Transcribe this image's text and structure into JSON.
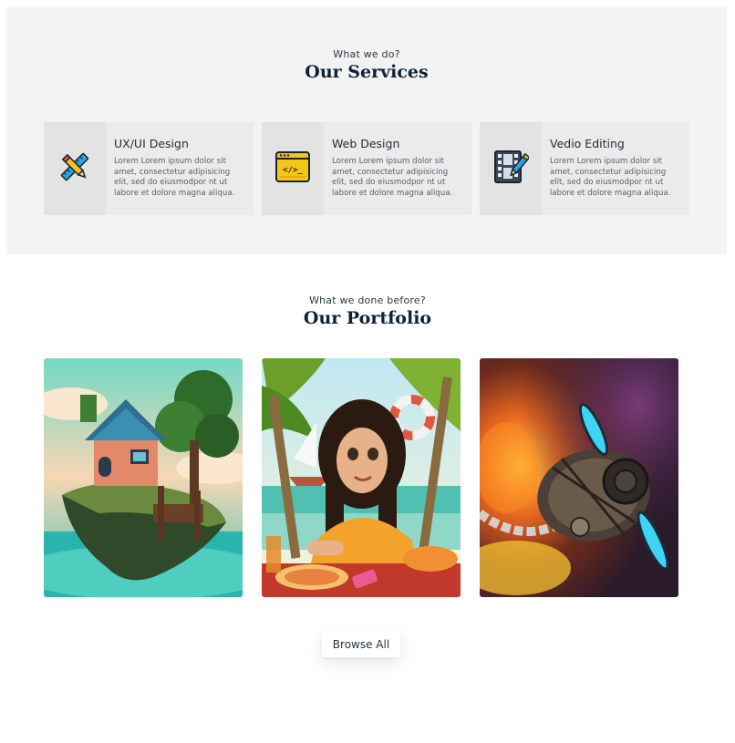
{
  "services": {
    "eyebrow": "What we do?",
    "title": "Our Services",
    "items": [
      {
        "title": "UX/UI Design",
        "text": "Lorem Lorem ipsum dolor sit amet, consectetur adipisicing elit, sed do eiusmodpor nt ut labore et dolore magna aliqua.",
        "icon": "pencil-ruler-icon"
      },
      {
        "title": "Web Design",
        "text": "Lorem Lorem ipsum dolor sit amet, consectetur adipisicing elit, sed do eiusmodpor nt ut labore et dolore magna aliqua.",
        "icon": "code-window-icon",
        "icon_code": "</>_"
      },
      {
        "title": "Vedio Editing",
        "text": "Lorem Lorem ipsum dolor sit amet, consectetur adipisicing elit, sed do eiusmodpor nt ut labore et dolore magna aliqua.",
        "icon": "film-edit-icon"
      }
    ]
  },
  "portfolio": {
    "eyebrow": "What we done before?",
    "title": "Our Portfolio",
    "items": [
      {
        "subject": "floating-island-house-illustration"
      },
      {
        "subject": "beach-girl-illustration"
      },
      {
        "subject": "steampunk-airship-illustration"
      }
    ],
    "browse_label": "Browse All"
  },
  "colors": {
    "services_bg": "#f3f3f3",
    "card_bg": "#ebebeb",
    "heading": "#0f2236",
    "icon_yellow": "#f5c518",
    "icon_blue": "#2aa3e0"
  }
}
